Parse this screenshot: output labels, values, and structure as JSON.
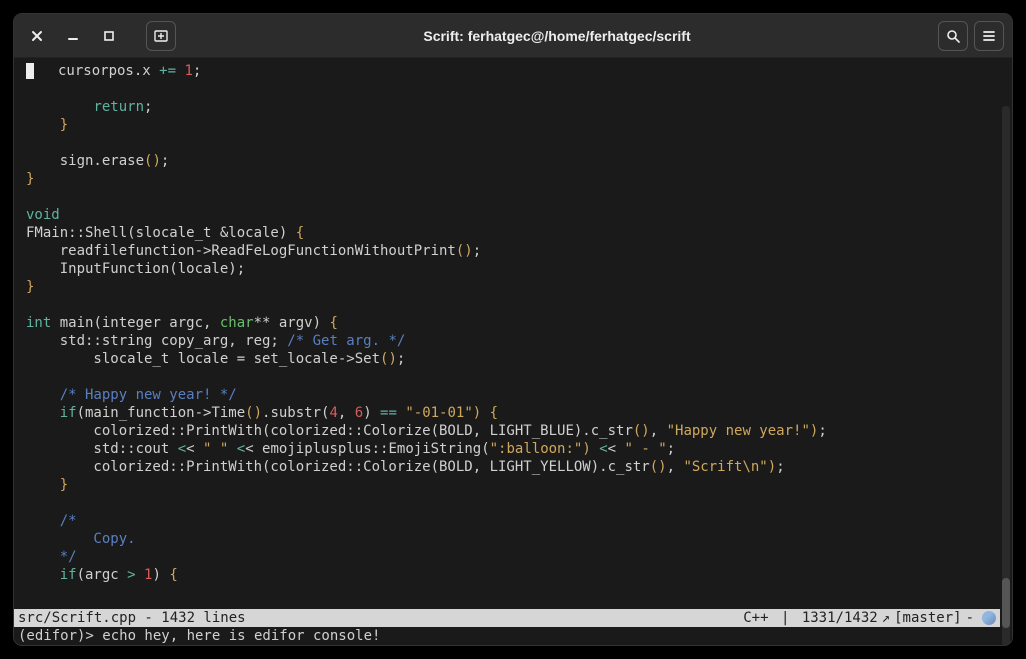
{
  "window": {
    "title": "Scrift: ferhatgec@/home/ferhatgec/scrift"
  },
  "status": {
    "file": "src/Scrift.cpp - 1432 lines",
    "lang": "C++",
    "pos": "1331/1432",
    "branch": "[master]",
    "tail": "-"
  },
  "console": {
    "line": "(edifor)> echo hey, here is edifor console!"
  },
  "code": {
    "l1a": "cursorpos.x ",
    "l1b": "+=",
    "l1c": " ",
    "l1d": "1",
    "l1e": ";",
    "ret": "return",
    "retsemi": ";",
    "rb1": "}",
    "l_sign": "    sign.erase",
    "l_sign_p": "()",
    "l_sign_s": ";",
    "rb2": "}",
    "void": "void",
    "shell_sig": "FMain::Shell(slocale_t &locale) ",
    "ob1": "{",
    "rd1": "    readfilefunction->ReadFeLogFunctionWithoutPrint",
    "rd1p": "()",
    "rd1s": ";",
    "rd2": "    InputFunction(locale);",
    "rb3": "}",
    "int": "int",
    "main_sig_a": " main(integer argc, ",
    "char": "char",
    "main_sig_b": "** argv) ",
    "ob2": "{",
    "copyarg": "    std::string copy_arg, reg; ",
    "cm_getarg": "/* Get arg. */",
    "setloc_a": "        slocale_t locale = set_locale->Set",
    "setloc_p": "()",
    "setloc_s": ";",
    "cm_hny": "    /* Happy new year! */",
    "if1": "if",
    "if1a": "(main_function->Time",
    "if1p": "()",
    "if1b": ".substr(",
    "n4": "4",
    "comma": ", ",
    "n6": "6",
    "if1c": ") ",
    "eqeq": "==",
    "sp": " ",
    "s0101": "\"-01-01\"",
    "cp1": ")",
    "ob3": "{",
    "pw1a": "        colorized::PrintWith(colorized::Colorize(BOLD, LIGHT_BLUE).c_str",
    "pw1p": "()",
    "pw1b": ", ",
    "s_hny": "\"Happy new year!\"",
    "cp2": ")",
    "pw1s": ";",
    "cout_a": "        std::cout ",
    "lt1": "<",
    "cout_b": "< ",
    "s_sp1": "\" \"",
    "cout_c": " ",
    "cout_d": "< emojiplusplus::EmojiString(",
    "s_balloon": "\":balloon:\"",
    "cp3": ")",
    "cout_e": " ",
    "cout_f": "< ",
    "s_dash": "\" - \"",
    "cout_g": ";",
    "pw2a": "        colorized::PrintWith(colorized::Colorize(BOLD, LIGHT_YELLOW).c_str",
    "pw2p": "()",
    "pw2b": ", ",
    "s_scrift": "\"Scrift\\n\"",
    "cp4": ")",
    "pw2s": ";",
    "rb4": "    }",
    "cm_o": "    /*",
    "cm_copy": "        Copy.",
    "cm_c": "    */",
    "if2": "if",
    "if2a": "(argc ",
    "gt": ">",
    "n1": "1",
    "if2b": ") ",
    "ob4": "{"
  }
}
